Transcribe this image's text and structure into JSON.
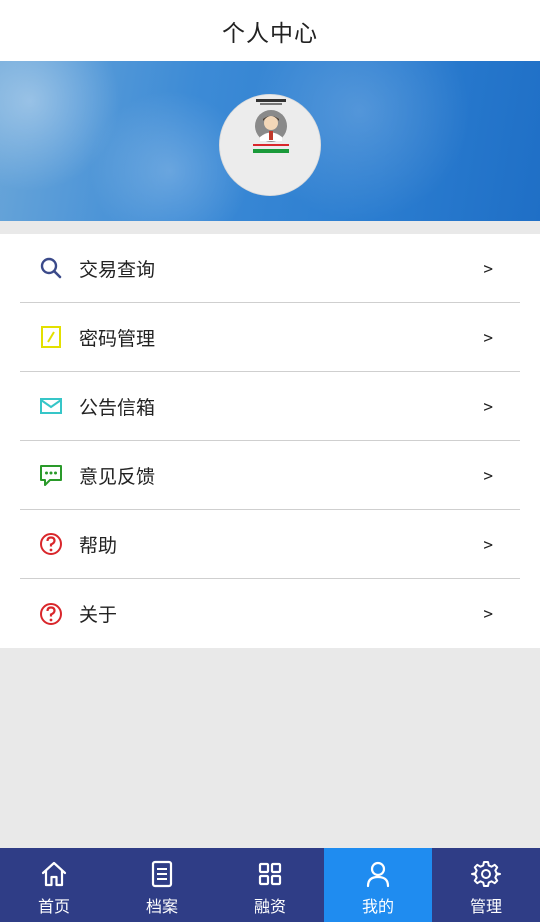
{
  "header": {
    "title": "个人中心"
  },
  "menu": {
    "items": [
      {
        "label": "交易查询",
        "arrow": ">",
        "icon": "search-icon",
        "color": "#3b4a8a"
      },
      {
        "label": "密码管理",
        "arrow": ">",
        "icon": "edit-icon",
        "color": "#e6e600"
      },
      {
        "label": "公告信箱",
        "arrow": ">",
        "icon": "mail-icon",
        "color": "#36c6c8"
      },
      {
        "label": "意见反馈",
        "arrow": ">",
        "icon": "feedback-icon",
        "color": "#2a9a2a"
      },
      {
        "label": "帮助",
        "arrow": ">",
        "icon": "help-icon",
        "color": "#d9262b"
      },
      {
        "label": "关于",
        "arrow": ">",
        "icon": "help-icon",
        "color": "#d9262b"
      }
    ]
  },
  "tabbar": {
    "active_index": 3,
    "active_color": "#1f8cf0",
    "bg_color": "#2f3d86",
    "tabs": [
      {
        "label": "首页",
        "icon": "home-icon"
      },
      {
        "label": "档案",
        "icon": "document-icon"
      },
      {
        "label": "融资",
        "icon": "grid-icon"
      },
      {
        "label": "我的",
        "icon": "user-icon"
      },
      {
        "label": "管理",
        "icon": "gear-icon"
      }
    ]
  }
}
